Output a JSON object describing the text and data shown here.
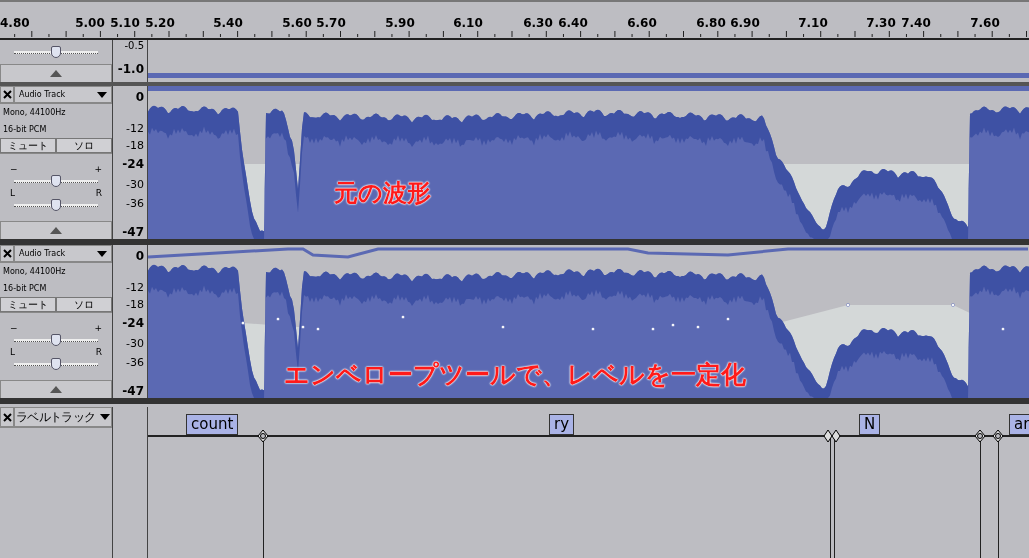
{
  "ruler": {
    "ticks": [
      "4.80",
      "5.00",
      "5.10",
      "5.20",
      "5.40",
      "5.60",
      "5.70",
      "5.90",
      "6.10",
      "6.30",
      "6.40",
      "6.60",
      "6.80",
      "6.90",
      "7.10",
      "7.30",
      "7.40",
      "7.60"
    ]
  },
  "top_track": {
    "scale": [
      "-0.5",
      "-1.0"
    ],
    "gain": {
      "level": 0.5
    }
  },
  "tracks": [
    {
      "name": "Audio Track",
      "info": [
        "Mono, 44100Hz",
        "16-bit PCM"
      ],
      "mute_label": "ミュート",
      "solo_label": "ソロ",
      "gain_min": "−",
      "gain_max": "+",
      "gain": {
        "level": 0.5
      },
      "pan_left": "L",
      "pan_right": "R",
      "pan": {
        "level": 0.5
      },
      "scale": [
        "0",
        "-12",
        "-18",
        "-24",
        "-30",
        "-36",
        "-47"
      ],
      "envelope": false,
      "annotation": "元の波形"
    },
    {
      "name": "Audio Track",
      "info": [
        "Mono, 44100Hz",
        "16-bit PCM"
      ],
      "mute_label": "ミュート",
      "solo_label": "ソロ",
      "gain_min": "−",
      "gain_max": "+",
      "gain": {
        "level": 0.5
      },
      "pan_left": "L",
      "pan_right": "R",
      "pan": {
        "level": 0.5
      },
      "scale": [
        "0",
        "-12",
        "-18",
        "-24",
        "-30",
        "-36",
        "-47"
      ],
      "envelope": true,
      "annotation": "エンベロープツールで、レベルを一定化"
    }
  ],
  "label_track": {
    "name": "ラベルトラック",
    "labels": [
      "count",
      "ry",
      "N",
      "ar"
    ]
  }
}
